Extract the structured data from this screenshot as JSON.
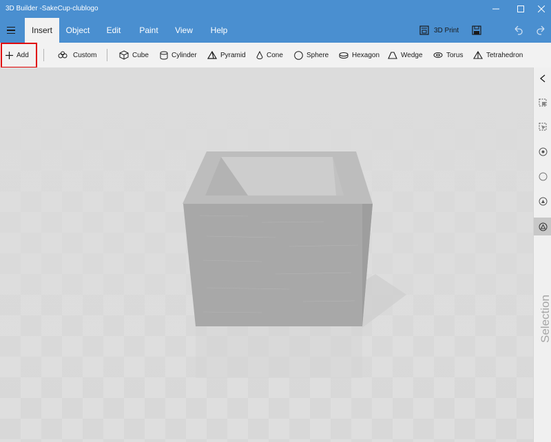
{
  "window": {
    "title": "3D Builder -SakeCup-clublogo",
    "minimize_icon": "minimize-icon",
    "maximize_icon": "maximize-icon",
    "close_icon": "close-icon"
  },
  "menu": {
    "hamburger_icon": "hamburger-icon",
    "tabs": [
      {
        "label": "Insert",
        "active": true
      },
      {
        "label": "Object"
      },
      {
        "label": "Edit"
      },
      {
        "label": "Paint"
      },
      {
        "label": "View"
      },
      {
        "label": "Help"
      }
    ],
    "print_label": "3D Print",
    "print_icon": "3d-print-icon",
    "save_icon": "save-icon",
    "undo_icon": "undo-icon",
    "redo_icon": "redo-icon"
  },
  "ribbon": {
    "add": {
      "label": "Add",
      "icon": "plus-icon"
    },
    "custom": {
      "label": "Custom",
      "icon": "custom-shapes-icon"
    },
    "shapes": [
      {
        "label": "Cube",
        "icon": "cube-icon"
      },
      {
        "label": "Cylinder",
        "icon": "cylinder-icon"
      },
      {
        "label": "Pyramid",
        "icon": "pyramid-icon"
      },
      {
        "label": "Cone",
        "icon": "cone-icon"
      },
      {
        "label": "Sphere",
        "icon": "sphere-icon"
      },
      {
        "label": "Hexagon",
        "icon": "hexagon-icon"
      },
      {
        "label": "Wedge",
        "icon": "wedge-icon"
      },
      {
        "label": "Torus",
        "icon": "torus-icon"
      },
      {
        "label": "Tetrahedron",
        "icon": "tetrahedron-icon"
      }
    ]
  },
  "sidebar": {
    "collapse_icon": "chevron-left-icon",
    "tools": [
      "select-objects-icon",
      "select-faces-icon",
      "select-vertices-icon",
      "select-all-icon",
      "select-edges-icon",
      "select-faces-mode-icon"
    ],
    "label": "Selection"
  },
  "colors": {
    "accent": "#4a8fd0",
    "ribbon_bg": "#f2f2f2",
    "highlight": "#e00000",
    "model": "#a5a5a5"
  }
}
